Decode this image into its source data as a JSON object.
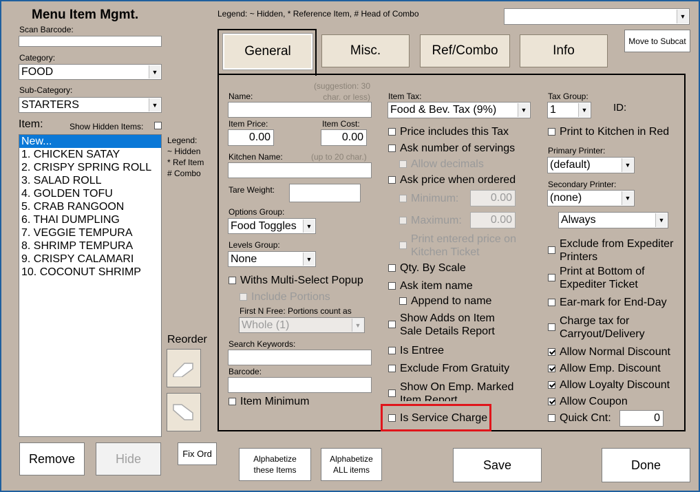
{
  "title": "Menu Item Mgmt.",
  "legend_top": "Legend: ~ Hidden, * Reference Item, # Head of Combo",
  "top_combo": "",
  "move_to_subcat": "Move to Subcat",
  "scan_barcode": {
    "label": "Scan Barcode:",
    "value": ""
  },
  "category": {
    "label": "Category:",
    "value": "FOOD"
  },
  "sub_category": {
    "label": "Sub-Category:",
    "value": "STARTERS"
  },
  "item_label": "Item:",
  "show_hidden_label": "Show Hidden Items:",
  "items": [
    "New...",
    "1. CHICKEN SATAY",
    "2. CRISPY SPRING ROLL",
    "3. SALAD ROLL",
    "4. GOLDEN TOFU",
    "5. CRAB RANGOON",
    "6. THAI DUMPLING",
    "7. VEGGIE TEMPURA",
    "8. SHRIMP TEMPURA",
    "9. CRISPY CALAMARI",
    "10. COCONUT SHRIMP"
  ],
  "legend_side": {
    "title": "Legend:",
    "hidden": "~ Hidden",
    "ref": "* Ref Item",
    "combo": "# Combo"
  },
  "reorder": "Reorder",
  "fix_ord": "Fix Ord",
  "remove": "Remove",
  "hide": "Hide",
  "alpha_these": [
    "Alphabetize",
    "these Items"
  ],
  "alpha_all": [
    "Alphabetize",
    "ALL items"
  ],
  "save": "Save",
  "done": "Done",
  "tabs": [
    "General",
    "Misc.",
    "Ref/Combo",
    "Info"
  ],
  "col1": {
    "name_label": "Name:",
    "name_hint": [
      "(suggestion: 30",
      "char. or less)"
    ],
    "name_value": "",
    "item_price_label": "Item Price:",
    "item_price": "0.00",
    "item_cost_label": "Item Cost:",
    "item_cost": "0.00",
    "kitchen_name_label": "Kitchen Name:",
    "kitchen_name_hint": "(up to 20 char.)",
    "tare_weight_label": "Tare Weight:",
    "options_group_label": "Options Group:",
    "options_group": "Food Toggles",
    "levels_group_label": "Levels Group:",
    "levels_group": "None",
    "withs_multi": "Withs Multi-Select Popup",
    "include_portions": "Include Portions",
    "first_n_free": "First N Free: Portions count as",
    "whole": "Whole (1)",
    "search_keywords_label": "Search Keywords:",
    "barcode_label": "Barcode:",
    "item_minimum": "Item Minimum"
  },
  "col2": {
    "item_tax_label": "Item Tax:",
    "item_tax": "Food & Bev. Tax (9%)",
    "price_includes_tax": "Price includes this Tax",
    "ask_servings": "Ask number of servings",
    "allow_decimals": "Allow decimals",
    "ask_price": "Ask price when ordered",
    "minimum": "Minimum:",
    "minimum_value": "0.00",
    "maximum": "Maximum:",
    "maximum_value": "0.00",
    "print_entered": [
      "Print entered price on",
      "Kitchen Ticket"
    ],
    "qty_by_scale": "Qty. By Scale",
    "ask_item_name": "Ask item name",
    "append_to_name": "Append to name",
    "show_adds": [
      "Show Adds on Item",
      "Sale Details Report"
    ],
    "is_entree": "Is Entree",
    "exclude_gratuity": "Exclude From Gratuity",
    "show_on_emp": [
      "Show On Emp. Marked",
      "Item Report"
    ],
    "is_service_charge": "Is Service Charge"
  },
  "col3": {
    "tax_group_label": "Tax Group:",
    "tax_group": "1",
    "id_label": "ID:",
    "print_kitchen_red": "Print to Kitchen in Red",
    "primary_printer_label": "Primary Printer:",
    "primary_printer": "(default)",
    "secondary_printer_label": "Secondary Printer:",
    "secondary_printer": "(none)",
    "always": "Always",
    "exclude_expediter": [
      "Exclude from Expediter",
      "Printers"
    ],
    "print_bottom": [
      "Print at Bottom of",
      "Expediter Ticket"
    ],
    "ear_mark": "Ear-mark for End-Day",
    "charge_tax": [
      "Charge tax for",
      "Carryout/Delivery"
    ],
    "allow_normal_discount": "Allow Normal Discount",
    "allow_emp_discount": "Allow Emp. Discount",
    "allow_loyalty_discount": "Allow Loyalty Discount",
    "allow_coupon": "Allow Coupon",
    "quick_cnt": "Quick Cnt:",
    "quick_cnt_value": "0"
  },
  "colors": {
    "background": "#c1b5a9",
    "selection": "#0a78d7",
    "highlight": "#e0151b"
  }
}
